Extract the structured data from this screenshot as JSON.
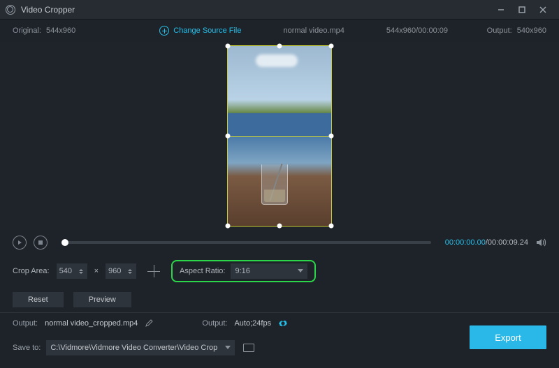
{
  "titlebar": {
    "title": "Video Cropper"
  },
  "infobar": {
    "original_label": "Original:",
    "original_value": "544x960",
    "change_source": "Change Source File",
    "filename": "normal video.mp4",
    "dims_time": "544x960/00:00:09",
    "output_label": "Output:",
    "output_value": "540x960"
  },
  "playback": {
    "current": "00:00:00.00",
    "total": "/00:00:09.24"
  },
  "controls": {
    "crop_area_label": "Crop Area:",
    "width": "540",
    "times": "×",
    "height": "960",
    "aspect_label": "Aspect Ratio:",
    "aspect_value": "9:16",
    "reset": "Reset",
    "preview": "Preview"
  },
  "output": {
    "out_label1": "Output:",
    "out_file": "normal video_cropped.mp4",
    "out_label2": "Output:",
    "out_format": "Auto;24fps",
    "save_label": "Save to:",
    "save_path": "C:\\Vidmore\\Vidmore Video Converter\\Video Crop",
    "export": "Export"
  }
}
